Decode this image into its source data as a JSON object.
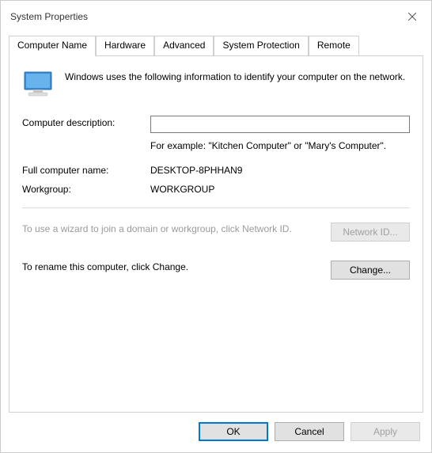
{
  "window": {
    "title": "System Properties"
  },
  "tabs": [
    {
      "label": "Computer Name"
    },
    {
      "label": "Hardware"
    },
    {
      "label": "Advanced"
    },
    {
      "label": "System Protection"
    },
    {
      "label": "Remote"
    }
  ],
  "panel": {
    "intro": "Windows uses the following information to identify your computer on the network.",
    "desc_label": "Computer description:",
    "desc_value": "",
    "example": "For example: \"Kitchen Computer\" or \"Mary's Computer\".",
    "fullname_label": "Full computer name:",
    "fullname_value": "DESKTOP-8PHHAN9",
    "workgroup_label": "Workgroup:",
    "workgroup_value": "WORKGROUP",
    "wizard_text": "To use a wizard to join a domain or workgroup, click Network ID.",
    "networkid_btn": "Network ID...",
    "rename_text": "To rename this computer, click Change.",
    "change_btn": "Change..."
  },
  "footer": {
    "ok": "OK",
    "cancel": "Cancel",
    "apply": "Apply"
  }
}
